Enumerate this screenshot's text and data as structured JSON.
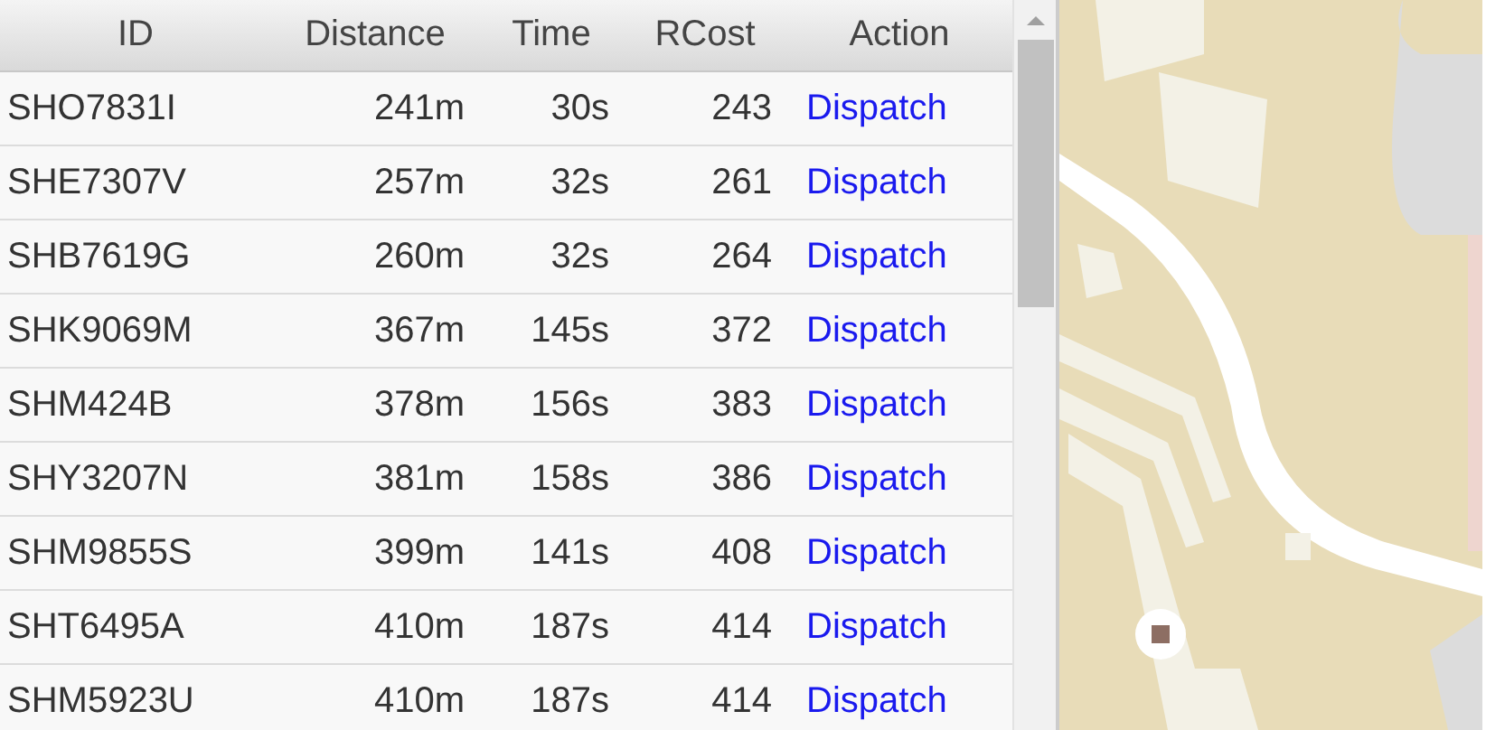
{
  "table": {
    "columns": [
      "ID",
      "Distance",
      "Time",
      "RCost",
      "Action"
    ],
    "rows": [
      {
        "id": "SHO7831I",
        "distance": "241m",
        "time": "30s",
        "rcost": "243",
        "action": "Dispatch"
      },
      {
        "id": "SHE7307V",
        "distance": "257m",
        "time": "32s",
        "rcost": "261",
        "action": "Dispatch"
      },
      {
        "id": "SHB7619G",
        "distance": "260m",
        "time": "32s",
        "rcost": "264",
        "action": "Dispatch"
      },
      {
        "id": "SHK9069M",
        "distance": "367m",
        "time": "145s",
        "rcost": "372",
        "action": "Dispatch"
      },
      {
        "id": "SHM424B",
        "distance": "378m",
        "time": "156s",
        "rcost": "383",
        "action": "Dispatch"
      },
      {
        "id": "SHY3207N",
        "distance": "381m",
        "time": "158s",
        "rcost": "386",
        "action": "Dispatch"
      },
      {
        "id": "SHM9855S",
        "distance": "399m",
        "time": "141s",
        "rcost": "408",
        "action": "Dispatch"
      },
      {
        "id": "SHT6495A",
        "distance": "410m",
        "time": "187s",
        "rcost": "414",
        "action": "Dispatch"
      },
      {
        "id": "SHM5923U",
        "distance": "410m",
        "time": "187s",
        "rcost": "414",
        "action": "Dispatch"
      }
    ]
  }
}
